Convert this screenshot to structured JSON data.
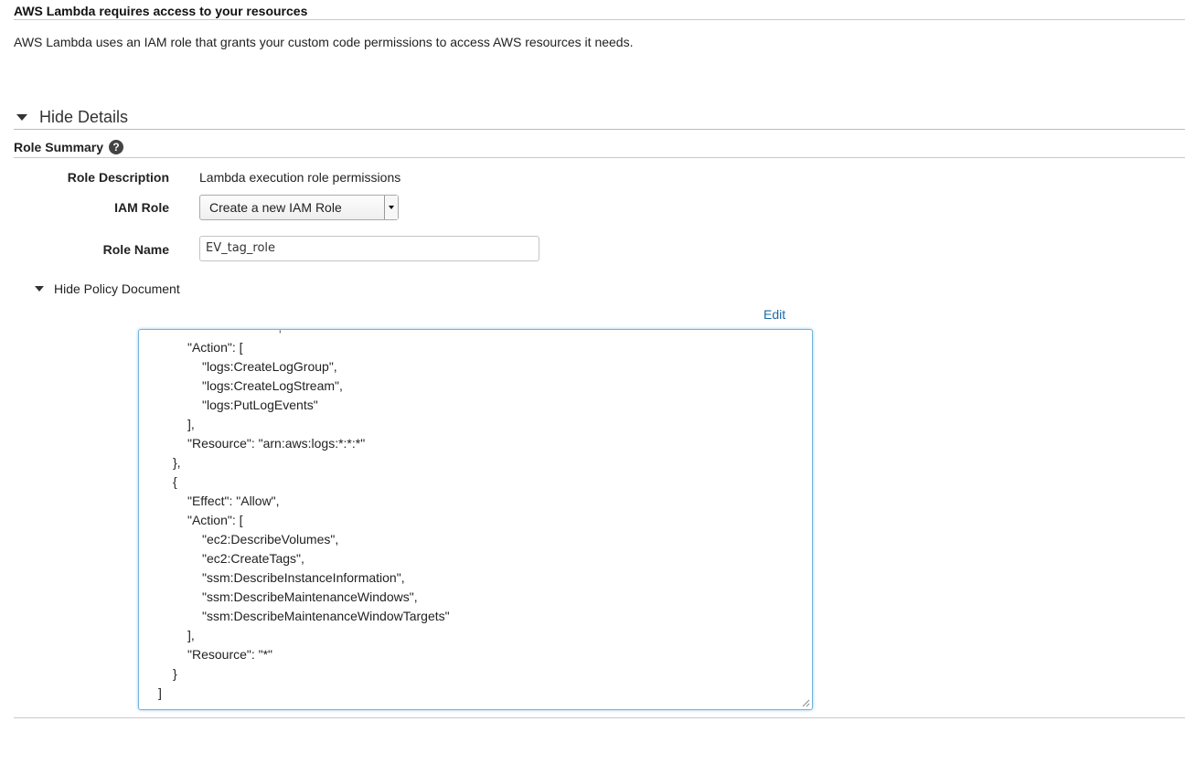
{
  "header": {
    "title": "AWS Lambda requires access to your resources",
    "description": "AWS Lambda uses an IAM role that grants your custom code permissions to access AWS resources it needs."
  },
  "details_toggle": {
    "label": "Hide Details"
  },
  "role_summary": {
    "title": "Role Summary",
    "help_glyph": "?",
    "fields": {
      "description": {
        "label": "Role Description",
        "value": "Lambda execution role permissions"
      },
      "iam_role": {
        "label": "IAM Role",
        "selected": "Create a new IAM Role"
      },
      "role_name": {
        "label": "Role Name",
        "value": "EV_tag_role"
      }
    }
  },
  "policy": {
    "toggle_label": "Hide Policy Document",
    "edit_label": "Edit",
    "lines": [
      "\"Action\": [",
      "\"logs:CreateLogGroup\",",
      "\"logs:CreateLogStream\",",
      "\"logs:PutLogEvents\"",
      "],",
      "\"Resource\": \"arn:aws:logs:*:*:*\"",
      "},",
      "{",
      "\"Effect\": \"Allow\",",
      "\"Action\": [",
      "\"ec2:DescribeVolumes\",",
      "\"ec2:CreateTags\",",
      "\"ssm:DescribeInstanceInformation\",",
      "\"ssm:DescribeMaintenanceWindows\",",
      "\"ssm:DescribeMaintenanceWindowTargets\"",
      "],",
      "\"Resource\": \"*\"",
      "}",
      "]"
    ]
  },
  "colors": {
    "link": "#1b6aa6",
    "editor_focus_border": "#72b4e0"
  },
  "icons": {
    "details": "triangle-down-icon",
    "help": "question-circle-icon",
    "select": "dropdown-caret-icon",
    "resize": "resize-grip-icon"
  }
}
